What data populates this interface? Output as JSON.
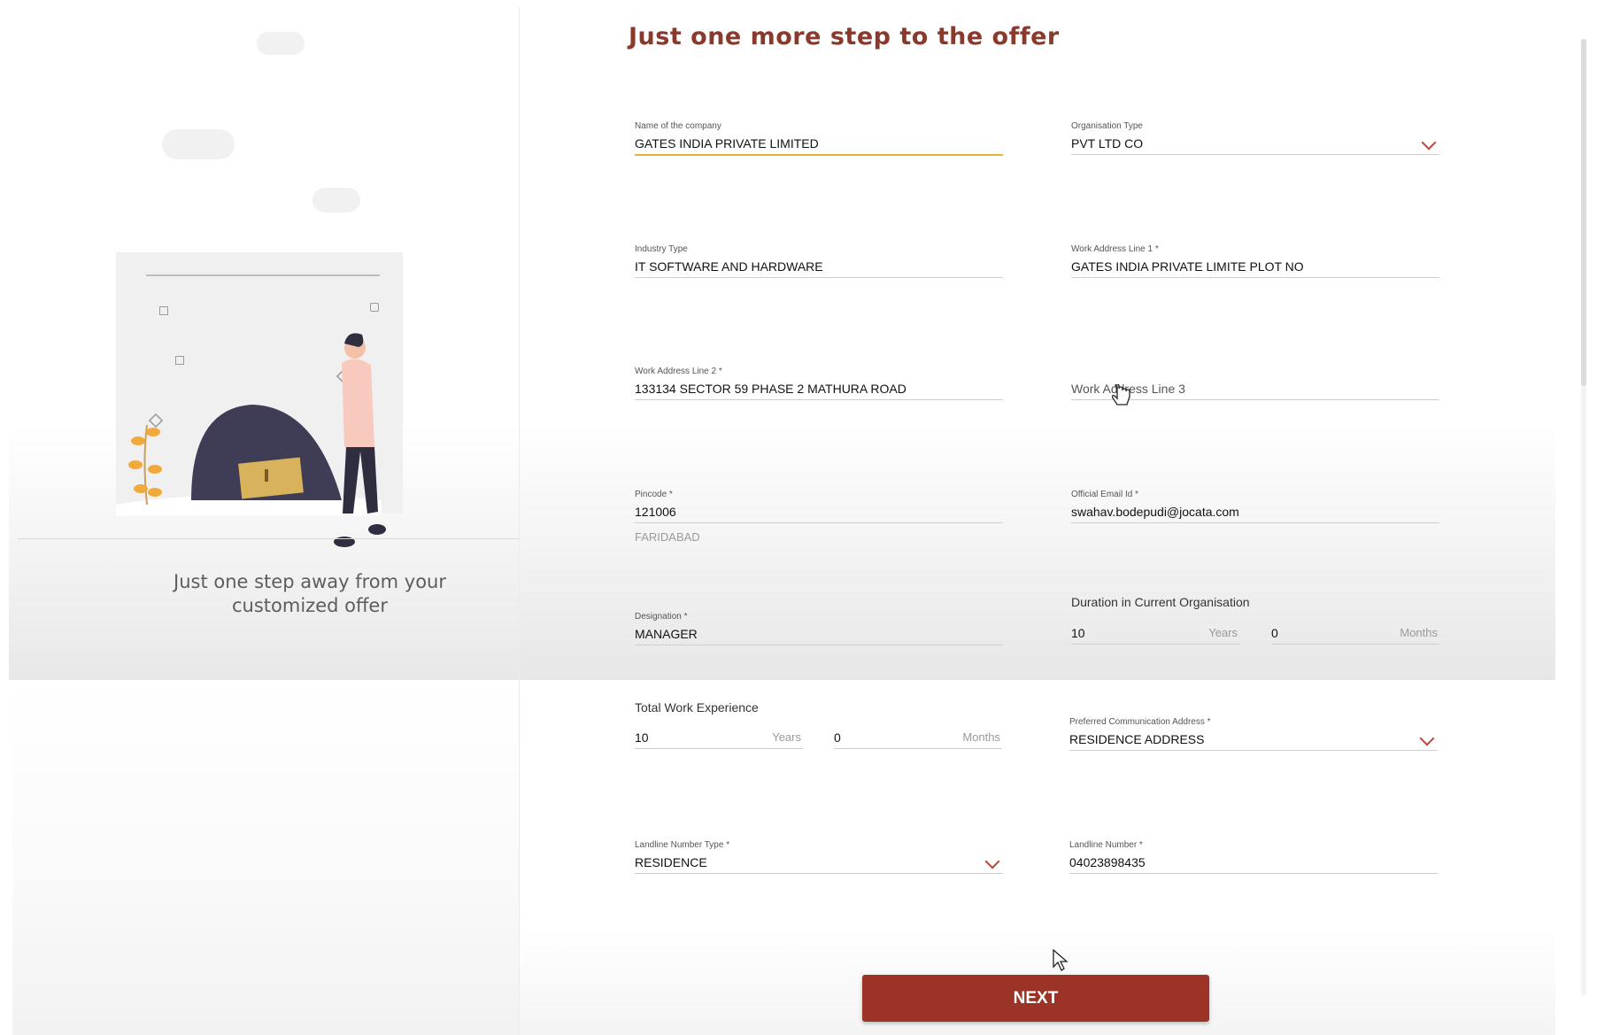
{
  "sidebar": {
    "tagline_line1": "Just one step away from your",
    "tagline_line2": "customized offer"
  },
  "form": {
    "title": "Just one more step to the offer",
    "company_name": {
      "label": "Name of the company",
      "value": "GATES INDIA PRIVATE LIMITED"
    },
    "organisation_type": {
      "label": "Organisation Type",
      "value": "PVT LTD CO"
    },
    "industry_type": {
      "label": "Industry Type",
      "value": "IT SOFTWARE AND HARDWARE"
    },
    "work_address_1": {
      "label": "Work Address Line 1 *",
      "value": "GATES INDIA PRIVATE LIMITE PLOT NO"
    },
    "work_address_2": {
      "label": "Work Address Line 2 *",
      "value": "133134 SECTOR 59 PHASE 2 MATHURA ROAD"
    },
    "work_address_3": {
      "placeholder": "Work Address Line 3"
    },
    "pincode": {
      "label": "Pincode *",
      "value": "121006",
      "city": "FARIDABAD"
    },
    "official_email": {
      "label": "Official Email Id *",
      "value": "swahav.bodepudi@jocata.com"
    },
    "designation": {
      "label": "Designation *",
      "value": "MANAGER"
    },
    "duration_current": {
      "title": "Duration in Current Organisation",
      "years": "10",
      "years_unit": "Years",
      "months": "0",
      "months_unit": "Months"
    },
    "total_experience": {
      "title": "Total Work Experience",
      "years": "10",
      "years_unit": "Years",
      "months": "0",
      "months_unit": "Months"
    },
    "preferred_address": {
      "label": "Preferred Communication Address *",
      "value": "RESIDENCE ADDRESS"
    },
    "landline_type": {
      "label": "Landline Number Type *",
      "value": "RESIDENCE"
    },
    "landline_number": {
      "label": "Landline Number *",
      "value": "04023898435"
    },
    "next_label": "NEXT"
  },
  "colors": {
    "accent": "#9b3426",
    "title": "#8a3a2c",
    "focus_underline": "#e6b23a",
    "chevron": "#b8473a"
  }
}
